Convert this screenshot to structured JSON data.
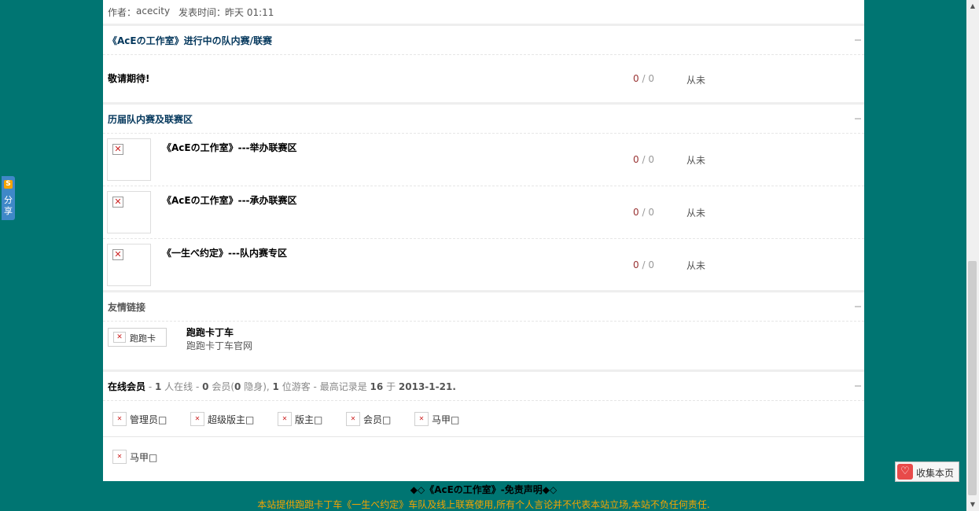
{
  "author_bar": {
    "author_label": "作者：",
    "author_name": "acecity",
    "time_label": "发表时间：",
    "time_value": "昨天 01:11"
  },
  "sections": {
    "ongoing": {
      "title": "《AcEの工作室》进行中の队内赛/联赛",
      "forums": [
        {
          "title": "敬请期待!",
          "topics": "0",
          "posts": "0",
          "last": "从未"
        }
      ]
    },
    "history": {
      "title": "历届队内赛及联赛区",
      "forums": [
        {
          "title": "《AcEの工作室》---举办联赛区",
          "topics": "0",
          "posts": "0",
          "last": "从未"
        },
        {
          "title": "《AcEの工作室》---承办联赛区",
          "topics": "0",
          "posts": "0",
          "last": "从未"
        },
        {
          "title": "《一生べ约定》---队内赛专区",
          "topics": "0",
          "posts": "0",
          "last": "从未"
        }
      ]
    },
    "links": {
      "title": "友情链接",
      "items": [
        {
          "image_alt": "跑跑卡",
          "name": "跑跑卡丁车",
          "desc": "跑跑卡丁车官网"
        }
      ]
    },
    "online": {
      "title": "在线会员",
      "summary": {
        "online_count": "1",
        "online_text": "人在线",
        "members_count": "0",
        "members_text": "会员(",
        "hidden_count": "0",
        "hidden_text": "隐身),",
        "guests_count": "1",
        "guests_text": "位游客 - 最高记录是",
        "record_count": "16",
        "record_prep": "于",
        "record_date": "2013-1-21."
      },
      "groups": [
        "管理员□",
        "超级版主□",
        "版主□",
        "会员□",
        "马甲□"
      ],
      "users": [
        "马甲□"
      ]
    }
  },
  "footer": {
    "disclaimer_title": "◆◇《AcEの工作室》-免责声明◆◇",
    "disclaimer_text": "本站提供跑跑卡丁车《一生べ约定》车队及线上联赛使用,所有个人言论并不代表本站立场,本站不负任何责任."
  },
  "share_widget": {
    "icon": "S",
    "label": "分享"
  },
  "favorite_button": {
    "label": "收集本页"
  },
  "count_separator": "/",
  "colors": {
    "background": "#007572",
    "title": "#04375c",
    "footer_text": "#f5a400"
  }
}
